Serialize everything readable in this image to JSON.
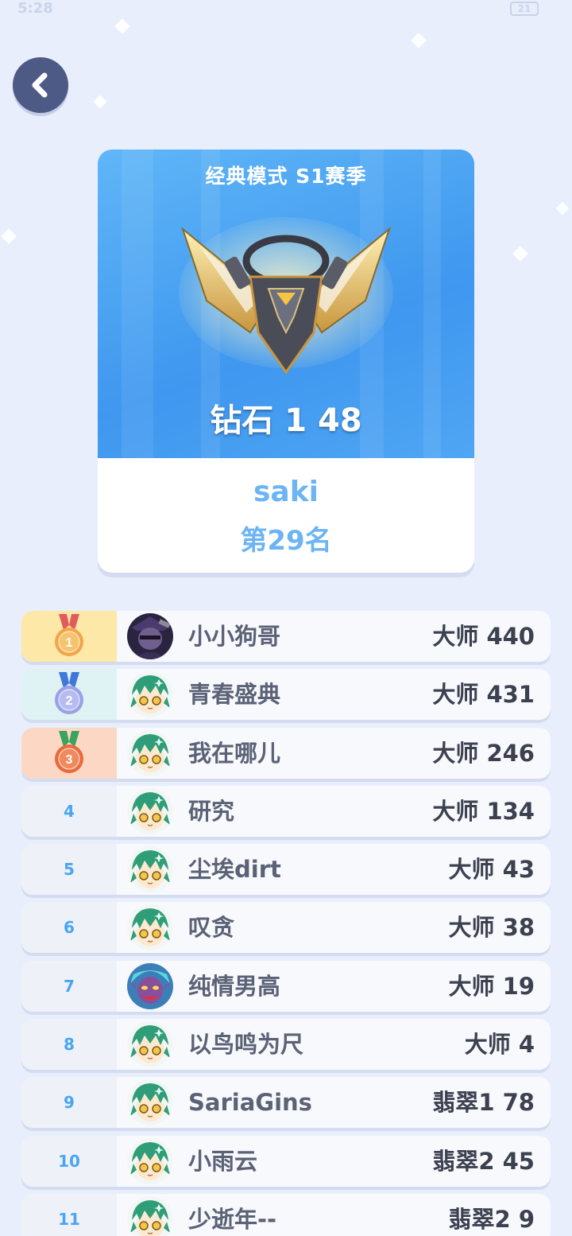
{
  "status": {
    "time": "5:28",
    "battery": "21"
  },
  "card": {
    "season_title": "经典模式 S1赛季",
    "tier": "钻石 1 48",
    "player_name": "saki",
    "position": "第29名"
  },
  "leaderboard": [
    {
      "rank": "1",
      "name": "小小狗哥",
      "score": "大师 440",
      "medal": "gold",
      "avatar": "villain"
    },
    {
      "rank": "2",
      "name": "青春盛典",
      "score": "大师 431",
      "medal": "silver",
      "avatar": "green-hair"
    },
    {
      "rank": "3",
      "name": "我在哪儿",
      "score": "大师 246",
      "medal": "bronze",
      "avatar": "green-hair"
    },
    {
      "rank": "4",
      "name": "研究",
      "score": "大师 134",
      "medal": "",
      "avatar": "green-hair"
    },
    {
      "rank": "5",
      "name": "尘埃dirt",
      "score": "大师 43",
      "medal": "",
      "avatar": "green-hair"
    },
    {
      "rank": "6",
      "name": "叹贪",
      "score": "大师 38",
      "medal": "",
      "avatar": "green-hair"
    },
    {
      "rank": "7",
      "name": "纯情男高",
      "score": "大师 19",
      "medal": "",
      "avatar": "demon"
    },
    {
      "rank": "8",
      "name": "以鸟鸣为尺",
      "score": "大师 4",
      "medal": "",
      "avatar": "green-hair"
    },
    {
      "rank": "9",
      "name": "SariaGins",
      "score": "翡翠1 78",
      "medal": "",
      "avatar": "green-hair"
    },
    {
      "rank": "10",
      "name": "小雨云",
      "score": "翡翠2 45",
      "medal": "",
      "avatar": "green-hair"
    },
    {
      "rank": "11",
      "name": "少逝年--",
      "score": "翡翠2 9",
      "medal": "",
      "avatar": "green-hair"
    }
  ],
  "colors": {
    "background": "#e8eefb",
    "card_blue": "#3f97ef",
    "accent_text": "#6cb4f3",
    "rank_number": "#4aa6f1",
    "gold": "#fde8a8",
    "silver": "#dff2f4",
    "bronze": "#fcd8c4"
  },
  "icons": {
    "back": "chevron-left-icon",
    "medal_gold": "medal-gold-icon",
    "medal_silver": "medal-silver-icon",
    "medal_bronze": "medal-bronze-icon",
    "emblem": "diamond-rank-emblem"
  }
}
